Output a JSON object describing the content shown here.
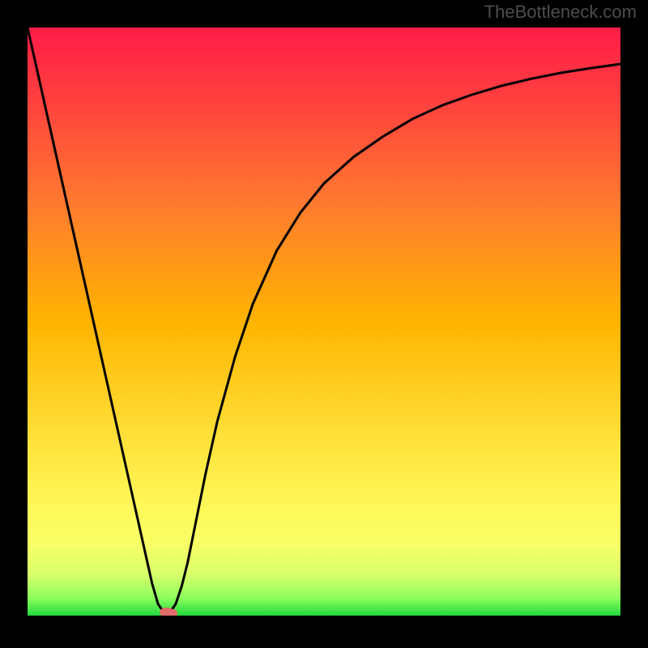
{
  "watermark": "TheBottleneck.com",
  "chart_data": {
    "type": "line",
    "title": "",
    "xlabel": "",
    "ylabel": "",
    "xlim": [
      0,
      100
    ],
    "ylim": [
      0,
      100
    ],
    "grid": false,
    "background_gradient": {
      "top_color": "#ff1744",
      "mid_color": "#ffc107",
      "bottom_color": "#1fce3a",
      "stops": [
        {
          "offset": 0.0,
          "color": "#ff1c47"
        },
        {
          "offset": 0.12,
          "color": "#ff3f3f"
        },
        {
          "offset": 0.3,
          "color": "#ff7a2f"
        },
        {
          "offset": 0.5,
          "color": "#ffb400"
        },
        {
          "offset": 0.7,
          "color": "#ffe13a"
        },
        {
          "offset": 0.82,
          "color": "#fff95a"
        },
        {
          "offset": 0.88,
          "color": "#f7ff66"
        },
        {
          "offset": 0.93,
          "color": "#d7ff6a"
        },
        {
          "offset": 0.97,
          "color": "#8dff5c"
        },
        {
          "offset": 1.0,
          "color": "#22d83e"
        }
      ]
    },
    "series": [
      {
        "name": "bottleneck-curve",
        "color": "#000000",
        "x": [
          0,
          2,
          4,
          6,
          8,
          10,
          12,
          14,
          16,
          18,
          20,
          21,
          22,
          23,
          23.5,
          24,
          25,
          26,
          27,
          28,
          30,
          32,
          35,
          38,
          42,
          46,
          50,
          55,
          60,
          65,
          70,
          75,
          80,
          85,
          90,
          95,
          100
        ],
        "values": [
          100,
          91,
          82,
          73,
          64,
          55,
          46,
          37,
          28,
          19,
          10,
          5.5,
          2,
          0.5,
          0,
          0.5,
          2,
          5,
          9,
          14,
          24,
          33,
          44,
          53,
          62,
          68.5,
          73.5,
          78,
          81.5,
          84.5,
          86.8,
          88.6,
          90.1,
          91.3,
          92.3,
          93.1,
          93.8
        ]
      }
    ],
    "marker": {
      "name": "minimum-marker",
      "x": 23.5,
      "y": 0,
      "color": "#e26b6b"
    }
  }
}
